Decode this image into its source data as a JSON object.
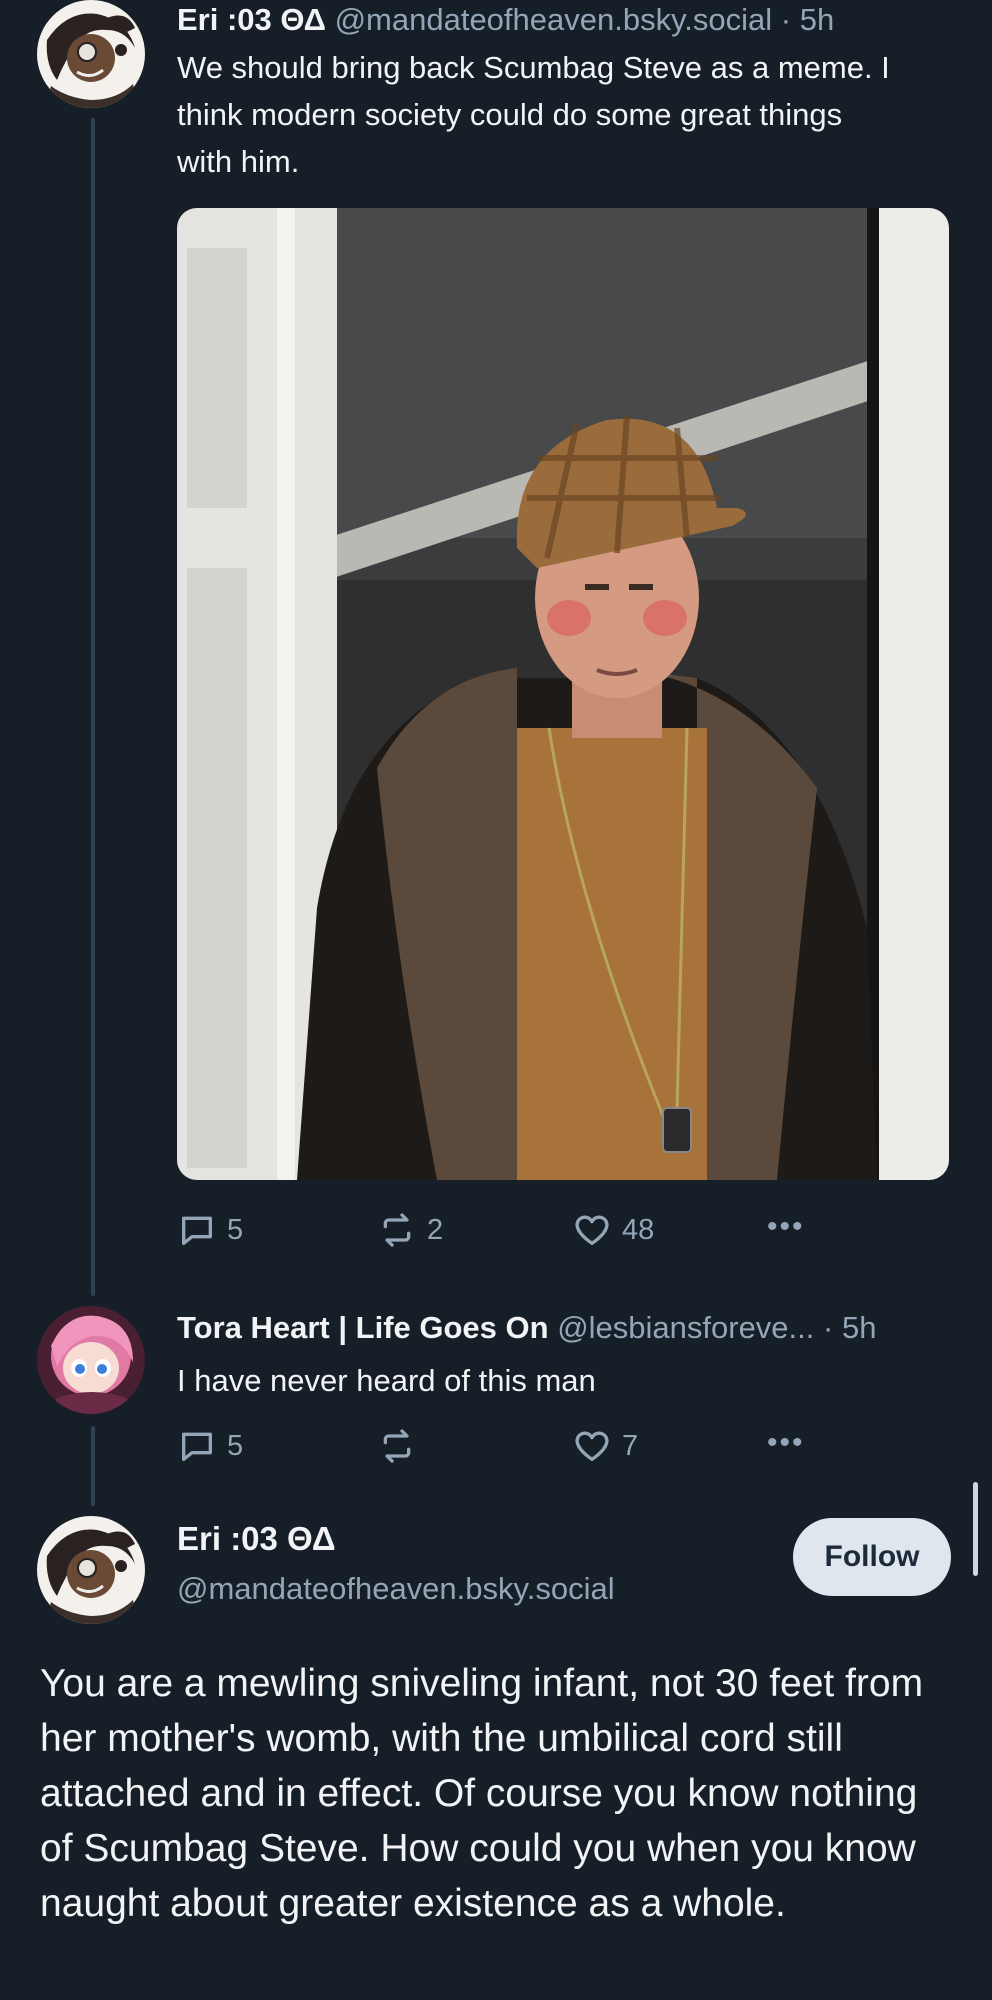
{
  "posts": [
    {
      "display_name": "Eri :03 ΘΔ",
      "handle": "@mandateofheaven.bsky.social",
      "time": "· 5h",
      "text": "We should bring back Scumbag Steve as a meme. I think modern society could do some great things with him.",
      "replies": "5",
      "reposts": "2",
      "likes": "48",
      "more": "•••"
    },
    {
      "display_name": "Tora Heart | Life Goes On",
      "handle": "@lesbiansforeve...",
      "time": "· 5h",
      "text": "I have never heard of this man",
      "replies": "5",
      "reposts": "",
      "likes": "7",
      "more": "•••"
    }
  ],
  "focused": {
    "display_name": "Eri :03 ΘΔ",
    "handle": "@mandateofheaven.bsky.social",
    "follow_label": "Follow",
    "text": "You are a mewling sniveling infant, not 30 feet from her mother's womb, with the umbilical cord still attached and in effect. Of course you know nothing of Scumbag Steve. How could you when you know naught about greater existence as a whole."
  },
  "icons": {
    "reply": "reply-icon",
    "repost": "repost-icon",
    "like": "heart-icon",
    "more": "more-icon"
  },
  "colors": {
    "background": "#161e27",
    "muted": "#93a5b7",
    "thread_line": "#2e4052",
    "follow_button": "#dfe6ee"
  }
}
